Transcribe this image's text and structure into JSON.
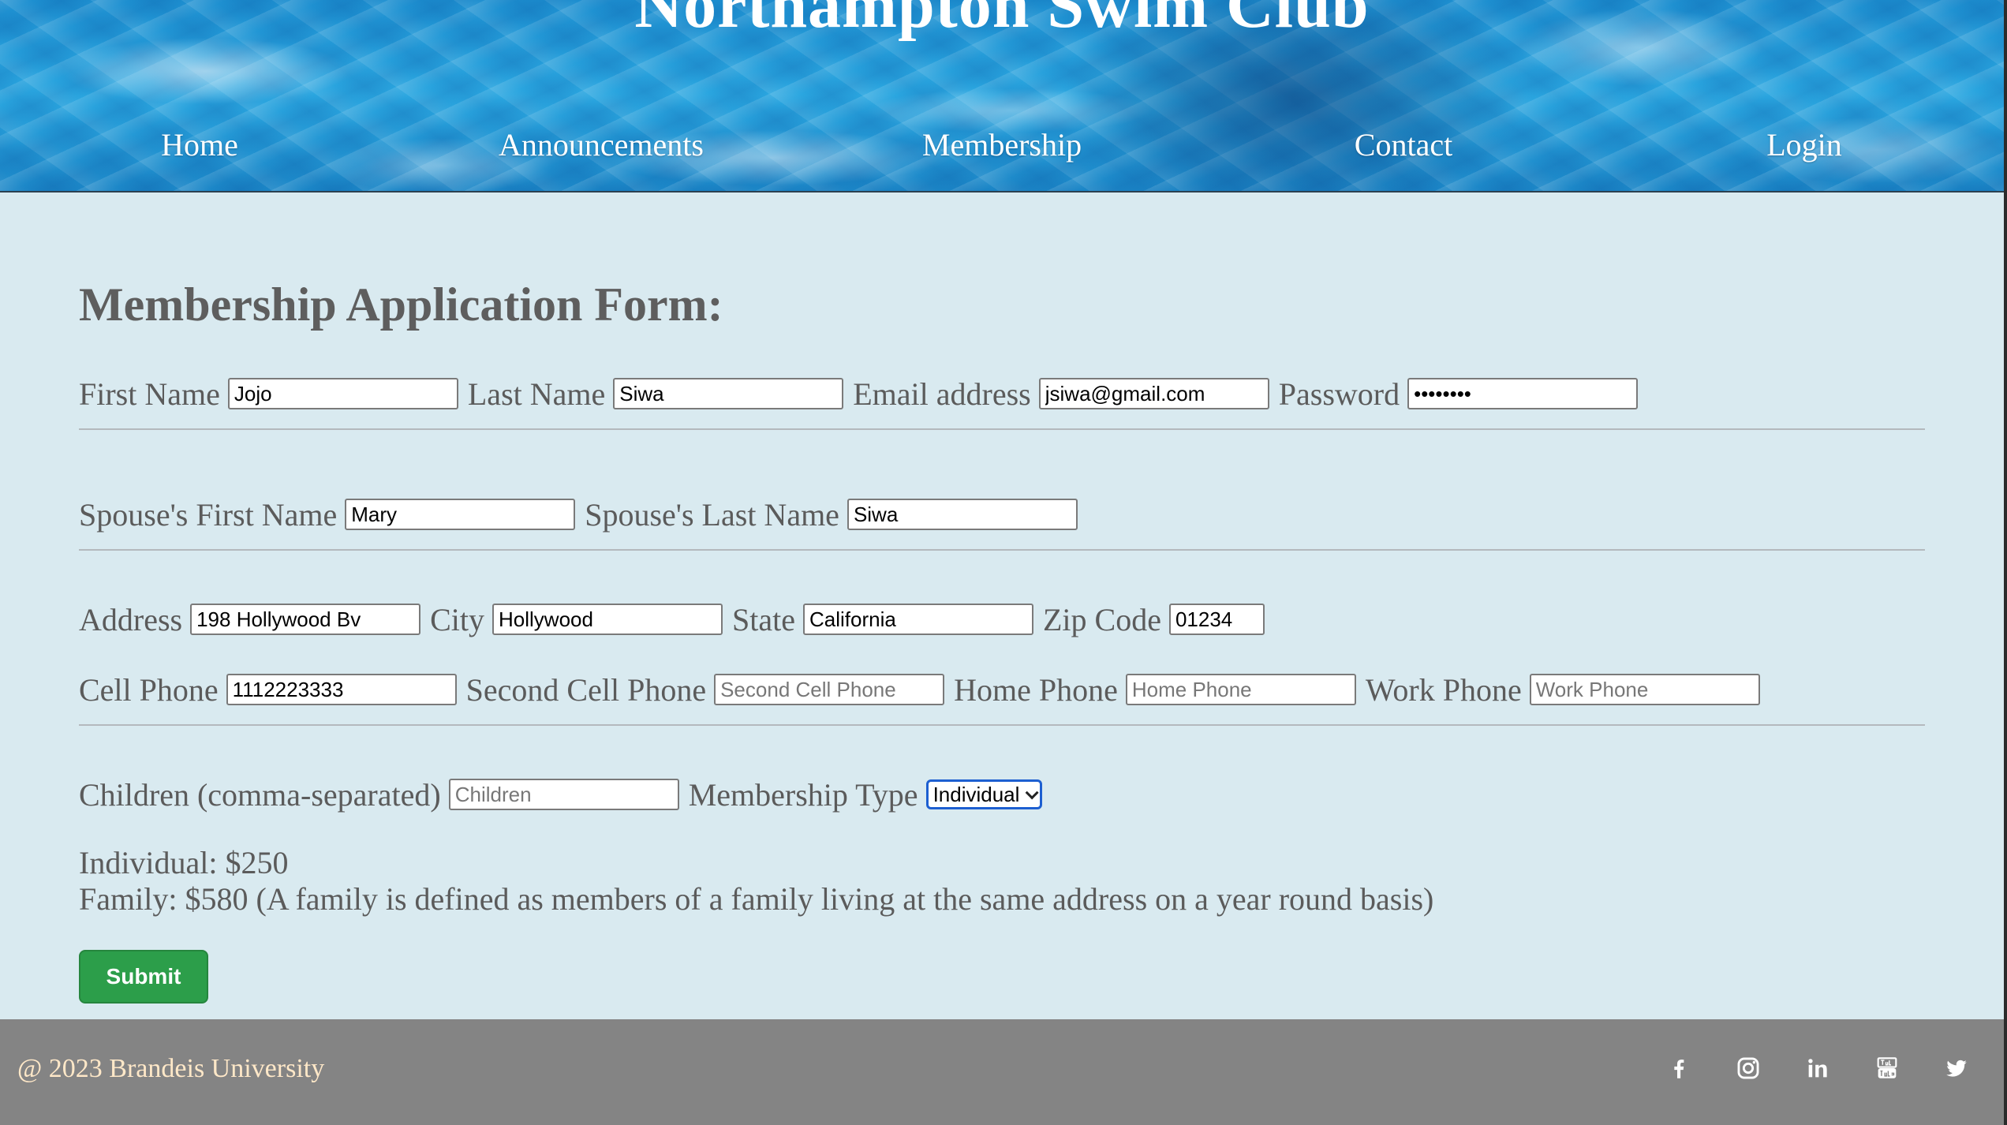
{
  "header": {
    "site_title": "Northampton Swim Club",
    "nav": [
      "Home",
      "Announcements",
      "Membership",
      "Contact",
      "Login"
    ]
  },
  "form": {
    "title": "Membership Application Form:",
    "first_name": {
      "label": "First Name",
      "value": "Jojo"
    },
    "last_name": {
      "label": "Last Name",
      "value": "Siwa"
    },
    "email": {
      "label": "Email address",
      "value": "jsiwa@gmail.com"
    },
    "password": {
      "label": "Password",
      "value": "••••••••"
    },
    "spouse_first": {
      "label": "Spouse's First Name",
      "value": "Mary"
    },
    "spouse_last": {
      "label": "Spouse's Last Name",
      "value": "Siwa"
    },
    "address": {
      "label": "Address",
      "value": "198 Hollywood Bv"
    },
    "city": {
      "label": "City",
      "value": "Hollywood"
    },
    "state": {
      "label": "State",
      "value": "California"
    },
    "zip": {
      "label": "Zip Code",
      "value": "01234"
    },
    "cell_phone": {
      "label": "Cell Phone",
      "value": "1112223333"
    },
    "second_cell": {
      "label": "Second Cell Phone",
      "placeholder": "Second Cell Phone"
    },
    "home_phone": {
      "label": "Home Phone",
      "placeholder": "Home Phone"
    },
    "work_phone": {
      "label": "Work Phone",
      "placeholder": "Work Phone"
    },
    "children": {
      "label": "Children (comma-separated)",
      "placeholder": "Children"
    },
    "membership_type": {
      "label": "Membership Type",
      "selected": "Individual"
    },
    "price_individual": "Individual: $250",
    "price_family": "Family: $580 (A family is defined as members of a family living at the same address on a year round basis)",
    "submit_label": "Submit"
  },
  "footer": {
    "copyright": "@ 2023 Brandeis University",
    "social_icons": [
      "facebook-icon",
      "instagram-icon",
      "linkedin-icon",
      "youtube-icon",
      "twitter-icon"
    ]
  }
}
